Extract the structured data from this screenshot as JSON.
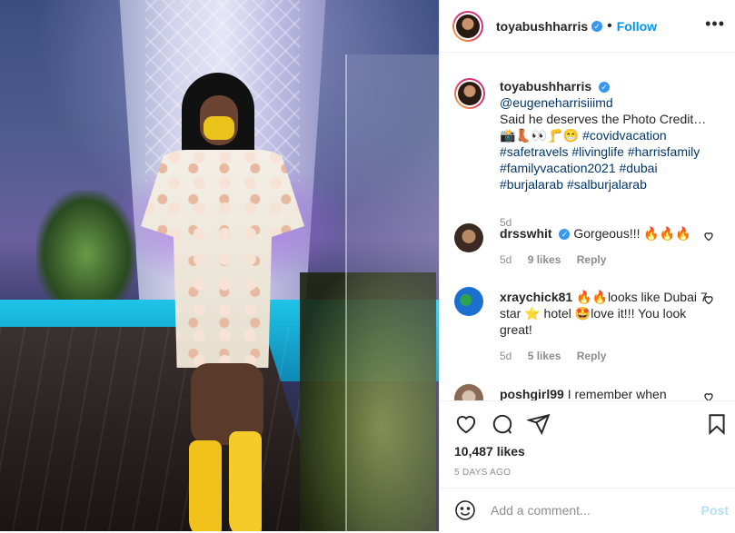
{
  "post": {
    "username": "toyabushharris",
    "follow_label": "Follow",
    "more_label": "•••"
  },
  "caption": {
    "username": "toyabushharris",
    "mention": "@eugeneharrisiiimd",
    "text": "Said he deserves the Photo Credit…",
    "emojis": "📸👢👀🦵😁",
    "hashtags_1": "#covidvacation",
    "hashtags_2": "#safetravels #livinglife #harrisfamily",
    "hashtags_3": "#familyvacation2021 #dubai",
    "hashtags_4": "#burjalarab #salburjalarab",
    "time": "5d"
  },
  "comments": [
    {
      "username": "drsswhit",
      "text": "Gorgeous!!! 🔥🔥🔥",
      "time": "5d",
      "likes": "9 likes",
      "reply": "Reply"
    },
    {
      "username": "xraychick81",
      "text": "🔥🔥looks like Dubai 7 star ⭐ hotel 🤩love it!!! You look great!",
      "time": "5d",
      "likes": "5 likes",
      "reply": "Reply"
    },
    {
      "username": "poshgirl99",
      "text": "I remember when"
    }
  ],
  "footer": {
    "likes": "10,487 likes",
    "date": "5 DAYS AGO",
    "comment_placeholder": "Add a comment...",
    "post_label": "Post"
  },
  "colors": {
    "accent": "#0095f6",
    "hashtag": "#00376b",
    "muted": "#8e8e8e"
  }
}
